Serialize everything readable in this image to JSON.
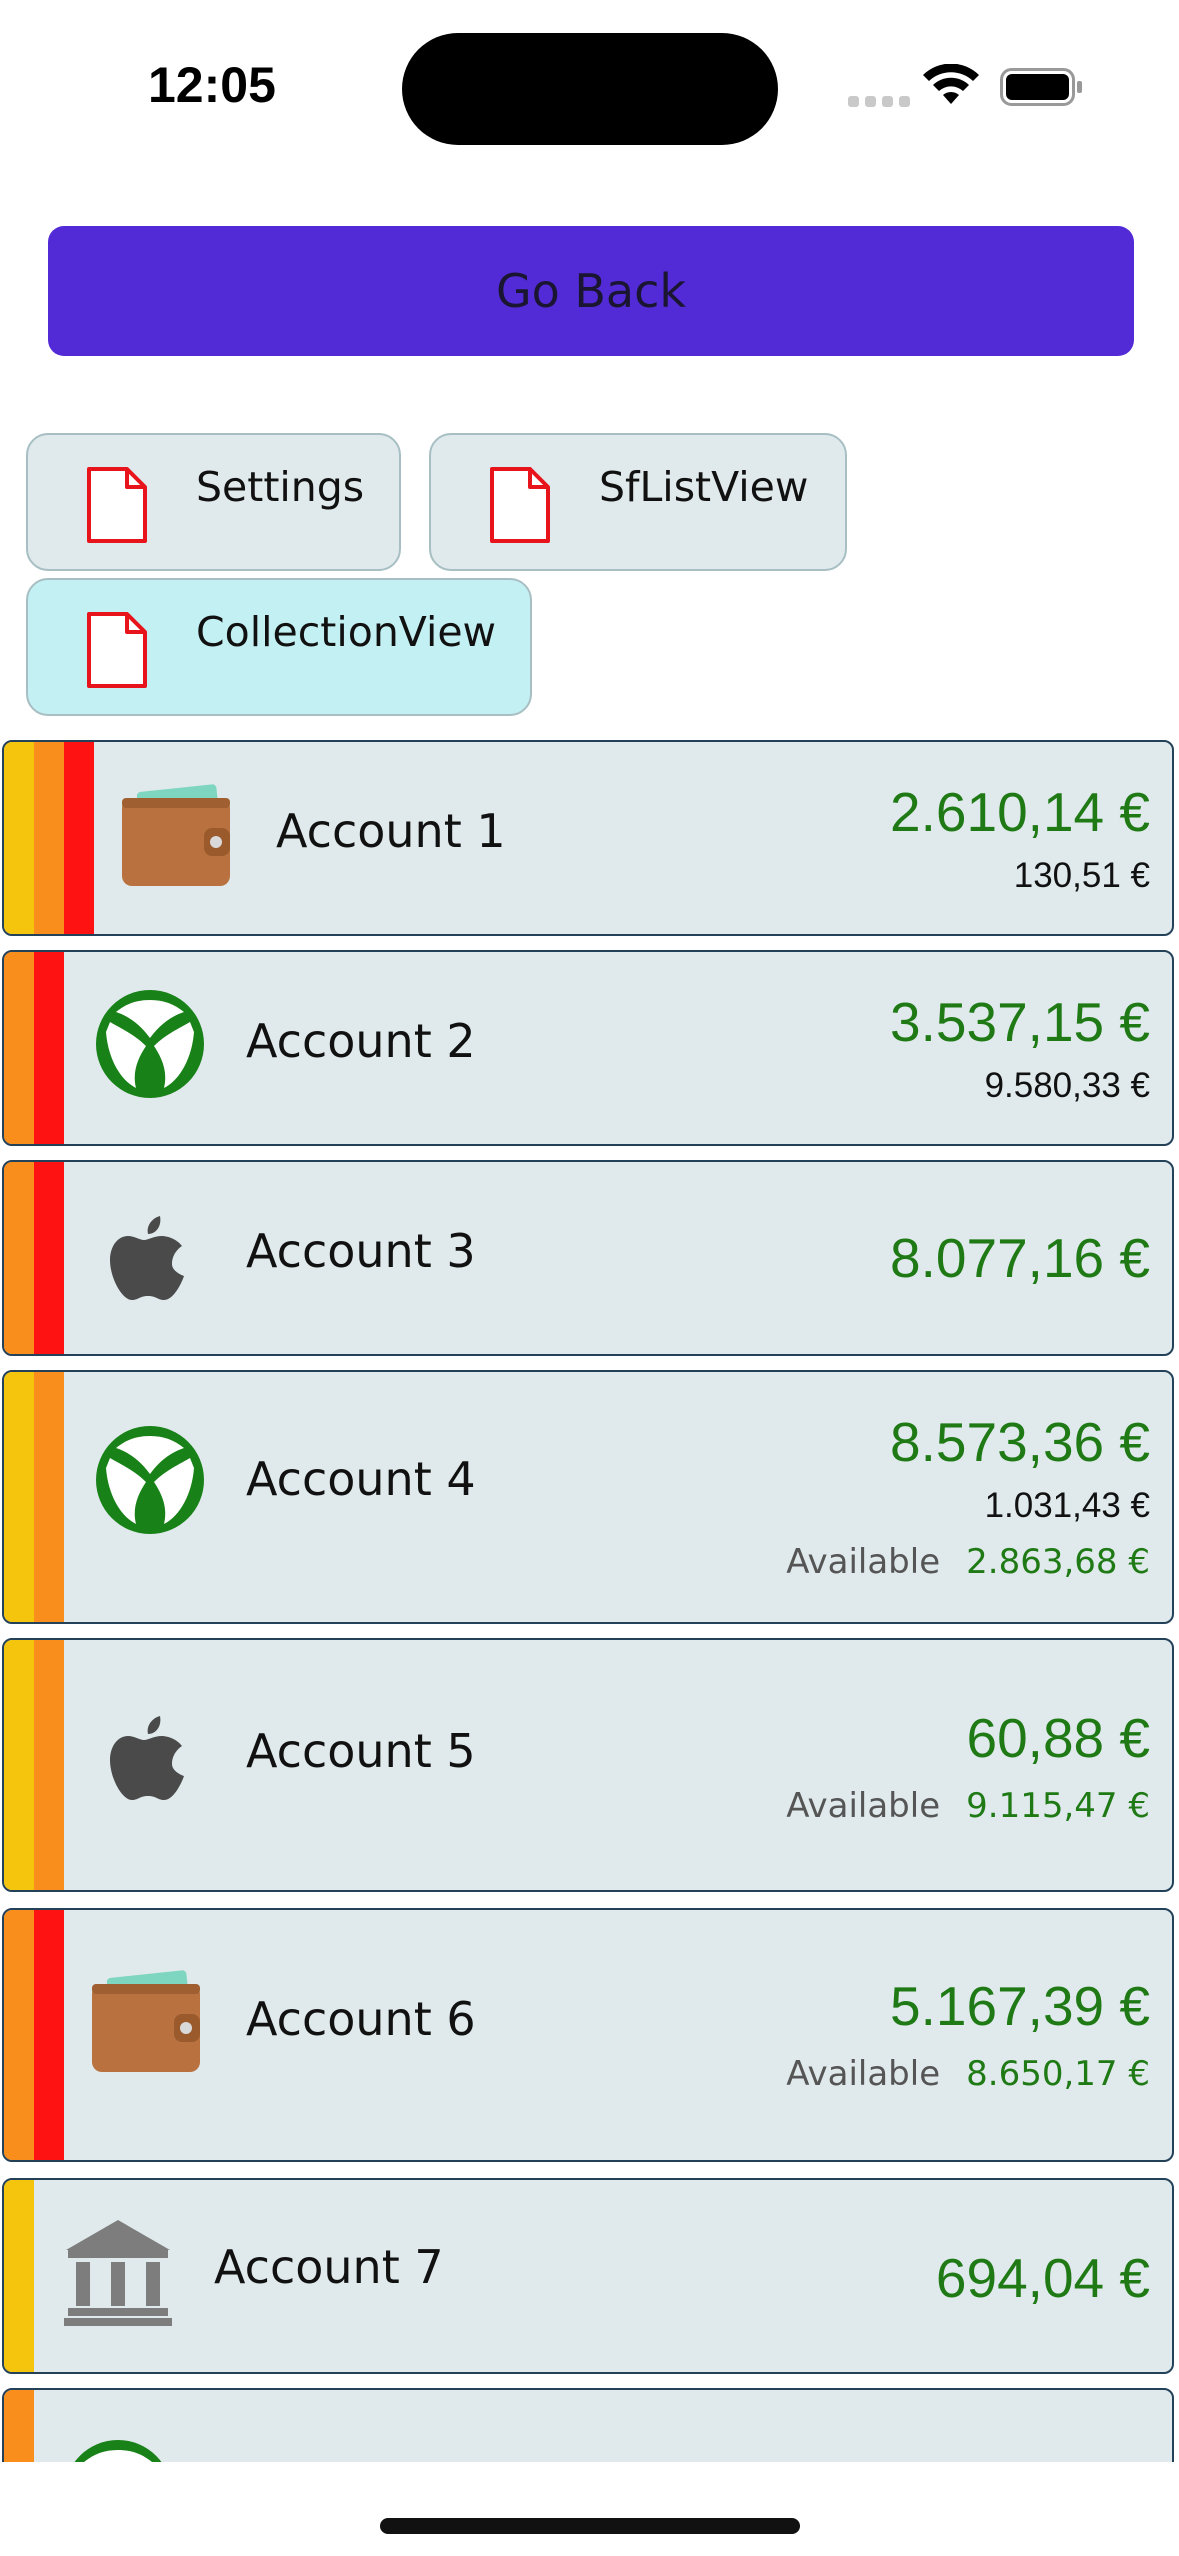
{
  "status_bar": {
    "time": "12:05"
  },
  "go_back": {
    "label": "Go Back"
  },
  "nav_chips": [
    {
      "label": "Settings",
      "icon": "document-icon",
      "active": false
    },
    {
      "label": "SfListView",
      "icon": "document-icon",
      "active": false
    },
    {
      "label": "CollectionView",
      "icon": "document-icon",
      "active": true
    }
  ],
  "accounts": [
    {
      "name": "Account 1",
      "icon": "wallet-icon",
      "stripes": [
        "#f5c50e",
        "#fa8e1c",
        "#ff1212"
      ],
      "balance": "2.610,14 €",
      "secondary": "130,51 €"
    },
    {
      "name": "Account 2",
      "icon": "xbox-icon",
      "stripes": [
        "#fa8e1c",
        "#ff1212"
      ],
      "balance": "3.537,15 €",
      "secondary": "9.580,33 €"
    },
    {
      "name": "Account 3",
      "icon": "apple-icon",
      "stripes": [
        "#fa8e1c",
        "#ff1212"
      ],
      "balance": "8.077,16 €"
    },
    {
      "name": "Account 4",
      "icon": "xbox-icon",
      "stripes": [
        "#f5c50e",
        "#fa8e1c"
      ],
      "balance": "8.573,36 €",
      "secondary": "1.031,43 €",
      "available_label": "Available",
      "available": "2.863,68 €"
    },
    {
      "name": "Account 5",
      "icon": "apple-icon",
      "stripes": [
        "#f5c50e",
        "#fa8e1c"
      ],
      "balance": "60,88 €",
      "available_label": "Available",
      "available": "9.115,47 €"
    },
    {
      "name": "Account 6",
      "icon": "wallet-icon",
      "stripes": [
        "#fa8e1c",
        "#ff1212"
      ],
      "balance": "5.167,39 €",
      "available_label": "Available",
      "available": "8.650,17 €"
    },
    {
      "name": "Account 7",
      "icon": "bank-icon",
      "stripes": [
        "#f5c50e"
      ],
      "balance": "694,04 €"
    },
    {
      "name": "",
      "icon": "xbox-icon",
      "stripes": [
        "#fa8e1c"
      ],
      "balance": ""
    }
  ],
  "colors": {
    "accent": "#532bd6",
    "card_background": "#e0eaec",
    "balance_green": "#1f7a16",
    "active_chip": "#c3f0f3"
  }
}
